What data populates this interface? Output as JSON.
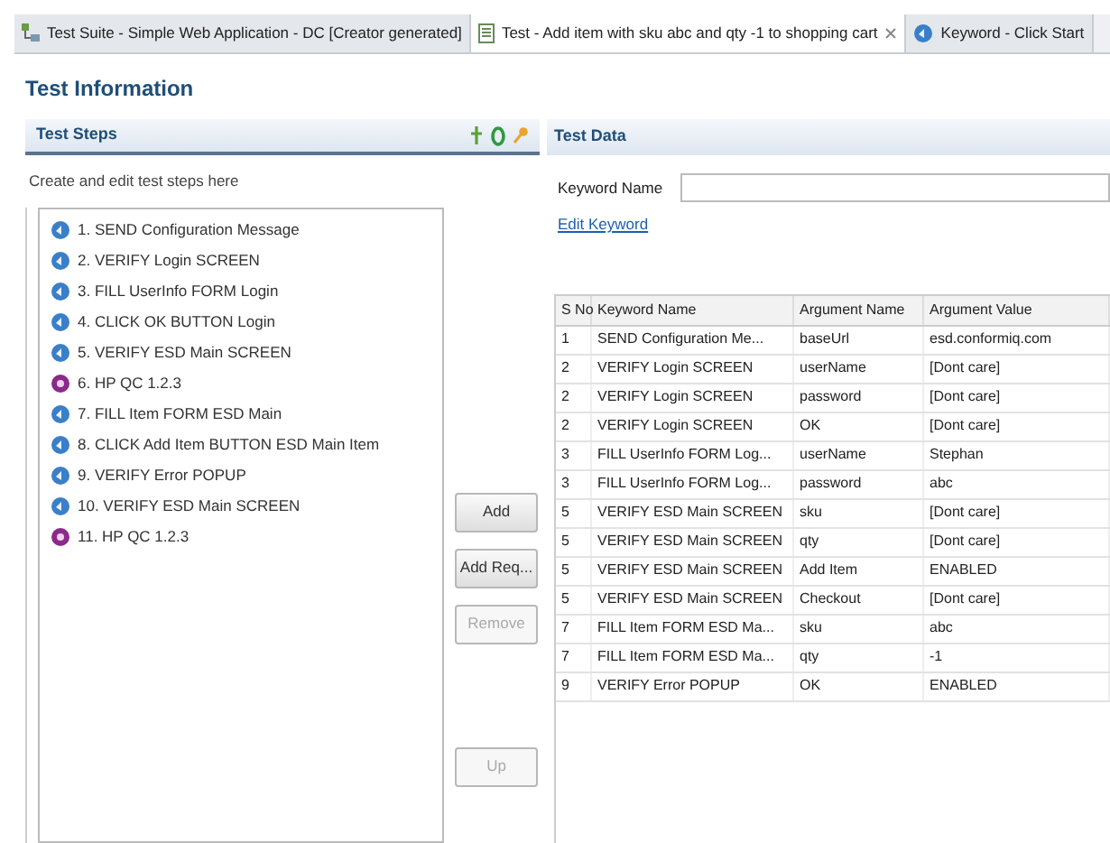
{
  "tabs": [
    {
      "label": "Test Suite - Simple Web Application - DC [Creator generated]",
      "kind": "suite",
      "selected": false
    },
    {
      "label": "Test - Add item with sku abc and qty -1 to shopping cart",
      "kind": "test",
      "selected": true
    },
    {
      "label": "Keyword - Click Start",
      "kind": "keyword",
      "selected": false
    }
  ],
  "title": "Test Information",
  "steps_panel": {
    "title": "Test Steps",
    "hint": "Create and edit test steps here",
    "steps": [
      {
        "label": "1. SEND Configuration Message",
        "kind": "keyword"
      },
      {
        "label": "2. VERIFY Login SCREEN",
        "kind": "keyword"
      },
      {
        "label": "3. FILL UserInfo FORM Login",
        "kind": "keyword"
      },
      {
        "label": "4. CLICK OK BUTTON Login",
        "kind": "keyword"
      },
      {
        "label": "5. VERIFY ESD Main SCREEN",
        "kind": "keyword"
      },
      {
        "label": "6. HP QC 1.2.3",
        "kind": "qc"
      },
      {
        "label": "7. FILL Item FORM ESD Main",
        "kind": "keyword"
      },
      {
        "label": "8. CLICK Add Item BUTTON ESD Main Item",
        "kind": "keyword"
      },
      {
        "label": "9. VERIFY Error POPUP",
        "kind": "keyword"
      },
      {
        "label": "10. VERIFY ESD Main SCREEN",
        "kind": "keyword"
      },
      {
        "label": "11. HP QC 1.2.3",
        "kind": "qc"
      }
    ],
    "buttons": [
      {
        "label": "Add",
        "disabled": false
      },
      {
        "label": "Add Req...",
        "disabled": false
      },
      {
        "label": "Remove",
        "disabled": true
      },
      {
        "label": "Up",
        "disabled": true
      }
    ]
  },
  "data_panel": {
    "title": "Test Data",
    "keyword_label": "Keyword Name",
    "edit_link": "Edit Keyword",
    "table": {
      "columns": [
        "S No",
        "Keyword Name",
        "Argument Name",
        "Argument Value"
      ],
      "rows": [
        [
          "1",
          "SEND Configuration Me...",
          "baseUrl",
          "esd.conformiq.com"
        ],
        [
          "2",
          "VERIFY Login SCREEN",
          "userName",
          "[Dont care]"
        ],
        [
          "2",
          "VERIFY Login SCREEN",
          "password",
          "[Dont care]"
        ],
        [
          "2",
          "VERIFY Login SCREEN",
          "OK",
          "[Dont care]"
        ],
        [
          "3",
          "FILL UserInfo FORM Log...",
          "userName",
          "Stephan"
        ],
        [
          "3",
          "FILL UserInfo FORM Log...",
          "password",
          "abc"
        ],
        [
          "5",
          "VERIFY ESD Main SCREEN",
          "sku",
          "[Dont care]"
        ],
        [
          "5",
          "VERIFY ESD Main SCREEN",
          "qty",
          "[Dont care]"
        ],
        [
          "5",
          "VERIFY ESD Main SCREEN",
          "Add Item",
          "ENABLED"
        ],
        [
          "5",
          "VERIFY ESD Main SCREEN",
          "Checkout",
          "[Dont care]"
        ],
        [
          "7",
          "FILL Item FORM ESD Ma...",
          "sku",
          "abc"
        ],
        [
          "7",
          "FILL Item FORM ESD Ma...",
          "qty",
          "-1"
        ],
        [
          "9",
          "VERIFY Error POPUP",
          "OK",
          "ENABLED"
        ]
      ]
    }
  }
}
